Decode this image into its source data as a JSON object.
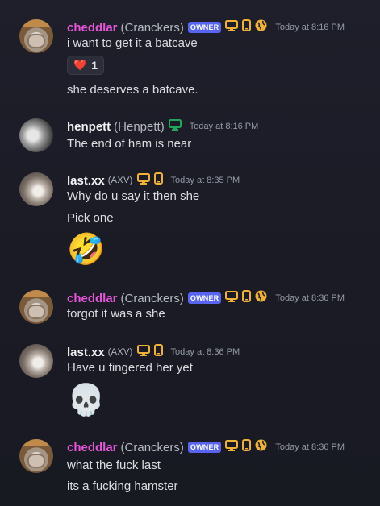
{
  "messages": [
    {
      "user": "cheddlar",
      "nick": "(Cranckers)",
      "badge": "OWNER",
      "time": "Today at 8:16 PM",
      "lines": [
        "i want to get it a batcave",
        "she deserves a batcave."
      ],
      "reaction": {
        "emoji": "❤️",
        "count": "1"
      }
    },
    {
      "user": "henpett",
      "nick": "(Henpett)",
      "time": "Today at 8:16 PM",
      "lines": [
        "The end of ham is near"
      ]
    },
    {
      "user": "last.xx",
      "tag": "(AXV)",
      "time": "Today at 8:35 PM",
      "lines": [
        "Why do u say it then she",
        "Pick one"
      ],
      "emoji": "🤣"
    },
    {
      "user": "cheddlar",
      "nick": "(Cranckers)",
      "badge": "OWNER",
      "time": "Today at 8:36 PM",
      "lines": [
        "forgot it was a she"
      ]
    },
    {
      "user": "last.xx",
      "tag": "(AXV)",
      "time": "Today at 8:36 PM",
      "lines": [
        "Have u fingered her yet"
      ],
      "emoji": "💀"
    },
    {
      "user": "cheddlar",
      "nick": "(Cranckers)",
      "badge": "OWNER",
      "time": "Today at 8:36 PM",
      "lines": [
        "what the fuck last",
        "its a fucking hamster"
      ]
    }
  ],
  "colors": {
    "owner_name": "#e456d7",
    "badge": "#5865f2",
    "icon": "#f0b232",
    "globe": "#f0b232",
    "desktop_green": "#23a55a"
  },
  "icons": [
    "desktop-icon",
    "mobile-icon",
    "globe-icon"
  ]
}
